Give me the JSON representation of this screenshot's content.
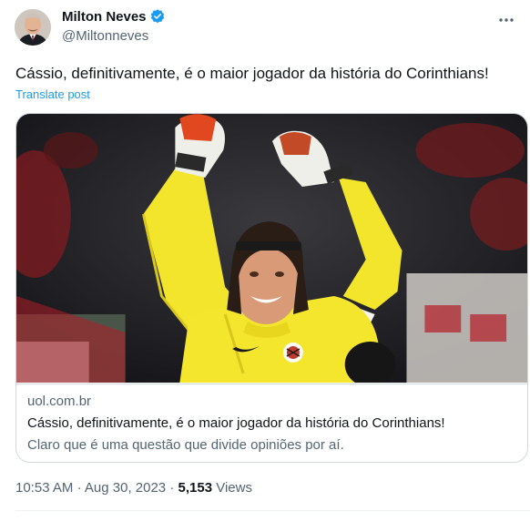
{
  "author": {
    "name": "Milton Neves",
    "handle": "@Miltonneves",
    "verified": true
  },
  "post": {
    "text": "Cássio, definitivamente, é o maior jogador da história do Corinthians!",
    "translate_label": "Translate post"
  },
  "link_card": {
    "domain": "uol.com.br",
    "title": "Cássio, definitivamente, é o maior jogador da história do Corinthians!",
    "description": "Claro que é uma questão que divide opiniões por aí."
  },
  "meta": {
    "time": "10:53 AM",
    "date": "Aug 30, 2023",
    "views_count": "5,153",
    "views_label": "Views",
    "separator": "·"
  },
  "icons": {
    "verified": "verified-badge-icon",
    "more": "more-options-icon"
  },
  "colors": {
    "accent": "#1d9bf0",
    "text_primary": "#0f1419",
    "text_secondary": "#536471",
    "border": "#cfd9de",
    "jersey": "#f2e52c"
  }
}
